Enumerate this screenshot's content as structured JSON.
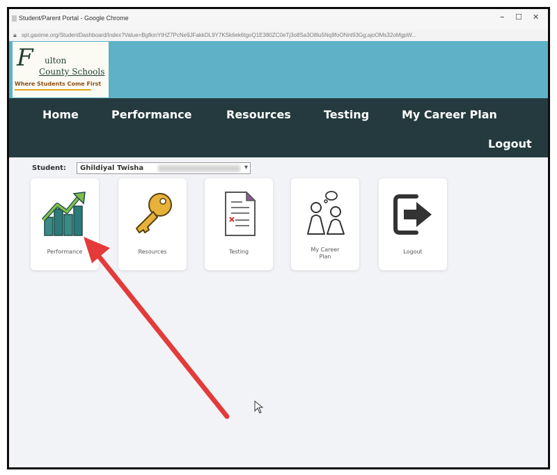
{
  "window": {
    "title": "Student/Parent Portal - Google Chrome",
    "controls": {
      "minimize": "–",
      "maximize": "☐",
      "close": "✕"
    }
  },
  "address_bar": {
    "url": "spt.gaxime.org/StudentDashboard/Index?Value=BgfkmYtHZ7PcNe9JFakkDL9Y7KSk6ek6tgoQ1E380ZC0eTj3o8Sa3O8lu5Nq9foONnt93Gg;ajoOMs32oMgpW..."
  },
  "logo": {
    "letter": "F",
    "line1": "ulton",
    "line2": "County Schools",
    "tagline": "Where Students Come First"
  },
  "nav": {
    "home": "Home",
    "performance": "Performance",
    "resources": "Resources",
    "testing": "Testing",
    "career": "My Career Plan",
    "logout": "Logout"
  },
  "student": {
    "label": "Student:",
    "selected": "Ghildiyal Twisha"
  },
  "tiles": {
    "performance": "Performance",
    "resources": "Resources",
    "testing": "Testing",
    "career": "My Career Plan",
    "logout": "Logout"
  },
  "colors": {
    "banner": "#5eb1c6",
    "nav": "#243a3e",
    "annotation_arrow": "#e53a3a"
  }
}
